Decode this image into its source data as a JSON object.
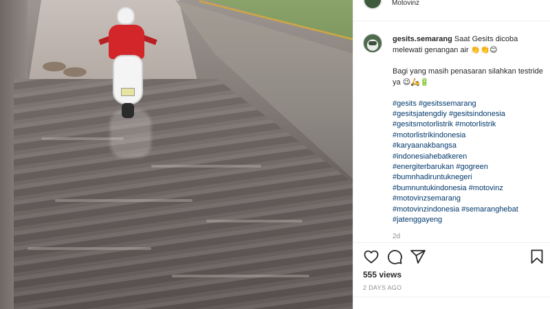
{
  "header": {
    "account_name": "Motovinz"
  },
  "post": {
    "username": "gesits.semarang",
    "caption_line1": "Saat Gesits dicoba melewati genangan air",
    "caption_line1_emoji": "👏👏😊",
    "caption_line2": "Bagi yang masih penasaran silahkan testride ya",
    "caption_line2_emoji": "😉🛵🔋",
    "hashtags": [
      "#gesits #gesitssemarang",
      "#gesitsjatengdiy #gesitsindonesia",
      "#gesitsmotorlistrik #motorlistrik",
      "#motorlistrikindonesia",
      "#karyaanakbangsa",
      "#indonesiahebatkeren",
      "#energiterbarukan #gogreen",
      "#bumnhadiruntuknegeri",
      "#bumnuntukindonesia #motovinz",
      "#motovinzsemarang",
      "#motovinzindonesia #semaranghebat",
      "#jatenggayeng"
    ],
    "time_ago": "2d",
    "views": "555 views",
    "date": "2 DAYS AGO"
  },
  "icons": {
    "like": "heart-icon",
    "comment": "comment-icon",
    "share": "paper-plane-icon",
    "save": "bookmark-icon"
  },
  "colors": {
    "hashtag": "#00376b",
    "muted": "#8e8e8e",
    "text": "#262626"
  }
}
